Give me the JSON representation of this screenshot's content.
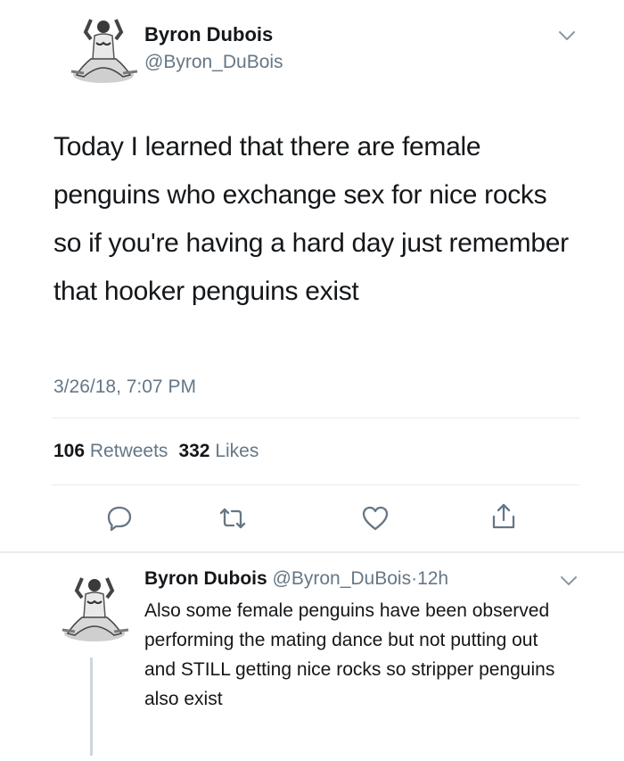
{
  "tweet": {
    "author_name": "Byron Dubois",
    "author_handle": "@Byron_DuBois",
    "text": "Today I learned that there are female penguins who exchange sex for nice rocks so if you're having a hard day just remember that hooker penguins exist",
    "timestamp": "3/26/18, 7:07 PM",
    "retweets_count": "106",
    "retweets_label": "Retweets",
    "likes_count": "332",
    "likes_label": "Likes"
  },
  "actions": [
    {
      "icon": "reply-icon"
    },
    {
      "icon": "retweet-icon"
    },
    {
      "icon": "like-icon"
    },
    {
      "icon": "share-icon"
    }
  ],
  "reply": {
    "author_name": "Byron Dubois",
    "author_handle": "@Byron_DuBois",
    "separator": "·",
    "time_ago": "12h",
    "text": "Also some female penguins have been observed performing the mating dance but not putting out and STILL getting nice rocks so stripper penguins also exist"
  },
  "colors": {
    "text_primary": "#14171a",
    "text_secondary": "#657786",
    "divider": "#e6ecf0",
    "thread_line": "#ccd6dd"
  }
}
